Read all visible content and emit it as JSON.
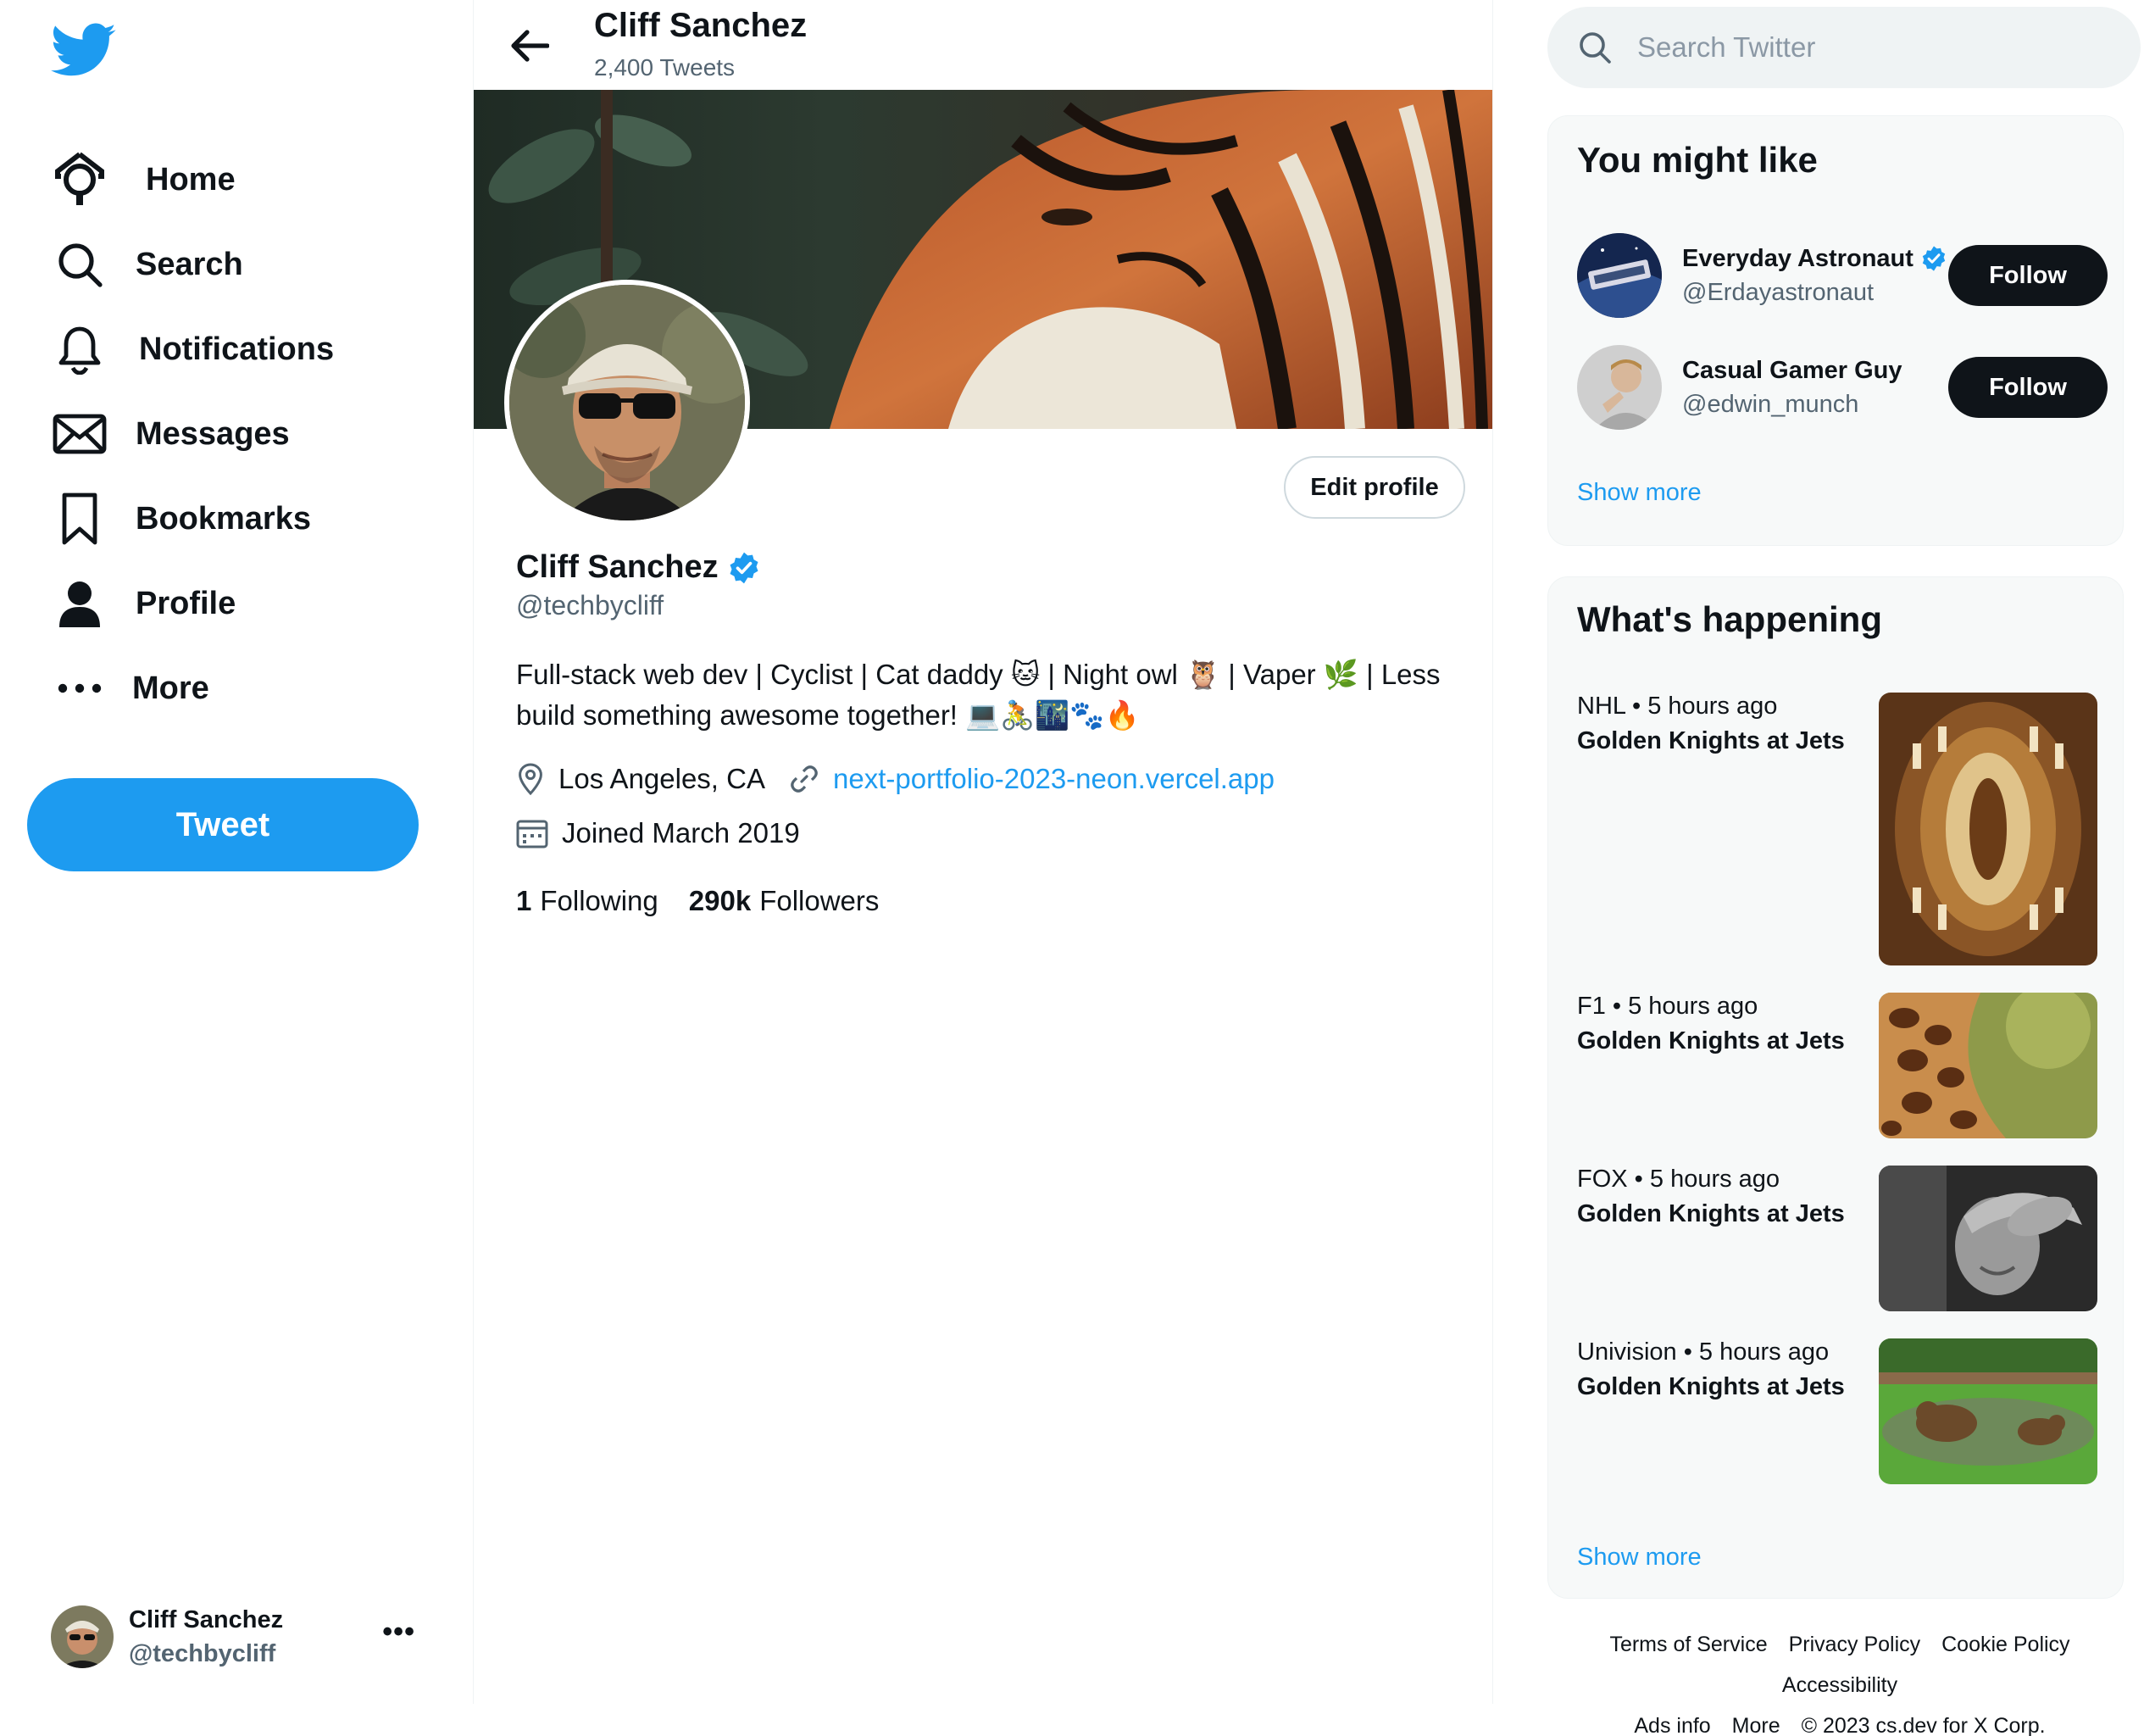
{
  "sidebar": {
    "logo": "twitter-bird-icon",
    "nav": [
      {
        "label": "Home",
        "icon": "home-icon"
      },
      {
        "label": "Search",
        "icon": "search-icon"
      },
      {
        "label": "Notifications",
        "icon": "bell-icon"
      },
      {
        "label": "Messages",
        "icon": "envelope-icon"
      },
      {
        "label": "Bookmarks",
        "icon": "bookmark-icon"
      },
      {
        "label": "Profile",
        "icon": "person-icon"
      },
      {
        "label": "More",
        "icon": "more-dots-icon"
      }
    ],
    "tweet_label": "Tweet",
    "account": {
      "name": "Cliff Sanchez",
      "handle": "@techbycliff"
    }
  },
  "header": {
    "title": "Cliff Sanchez",
    "subtitle": "2,400 Tweets"
  },
  "profile": {
    "name": "Cliff Sanchez",
    "handle": "@techbycliff",
    "edit_label": "Edit profile",
    "bio_line1": "Full-stack web dev | Cyclist | Cat daddy 🐱 | Night owl 🦉 | Vaper 🌿 | Less",
    "bio_line2": "build something awesome together! 💻🚴🌃🐾🔥",
    "location": "Los Angeles, CA",
    "link": "next-portfolio-2023-neon.vercel.app",
    "joined": "Joined March 2019",
    "following_count": "1",
    "following_label": "Following",
    "followers_count": "290k",
    "followers_label": "Followers"
  },
  "search": {
    "placeholder": "Search Twitter"
  },
  "who_to_follow": {
    "title": "You might like",
    "users": [
      {
        "name": "Everyday Astronaut",
        "handle": "@Erdayastronaut",
        "verified": true,
        "follow_label": "Follow"
      },
      {
        "name": "Casual Gamer Guy",
        "handle": "@edwin_munch",
        "verified": false,
        "follow_label": "Follow"
      }
    ],
    "show_more": "Show more"
  },
  "trends": {
    "title": "What's happening",
    "items": [
      {
        "meta": "NHL • 5 hours ago",
        "title": "Golden Knights at Jets"
      },
      {
        "meta": "F1 • 5 hours ago",
        "title": "Golden Knights at Jets"
      },
      {
        "meta": "FOX • 5 hours ago",
        "title": "Golden Knights at Jets"
      },
      {
        "meta": "Univision • 5 hours ago",
        "title": "Golden Knights at Jets"
      }
    ],
    "show_more": "Show more"
  },
  "footer": {
    "links": [
      "Terms of Service",
      "Privacy Policy",
      "Cookie Policy",
      "Accessibility"
    ],
    "links2": [
      "Ads info",
      "More",
      "© 2023 cs.dev for X Corp."
    ]
  },
  "colors": {
    "accent": "#1d9bf0",
    "text": "#0f1419",
    "muted": "#536471",
    "card": "#f7f9f9"
  }
}
